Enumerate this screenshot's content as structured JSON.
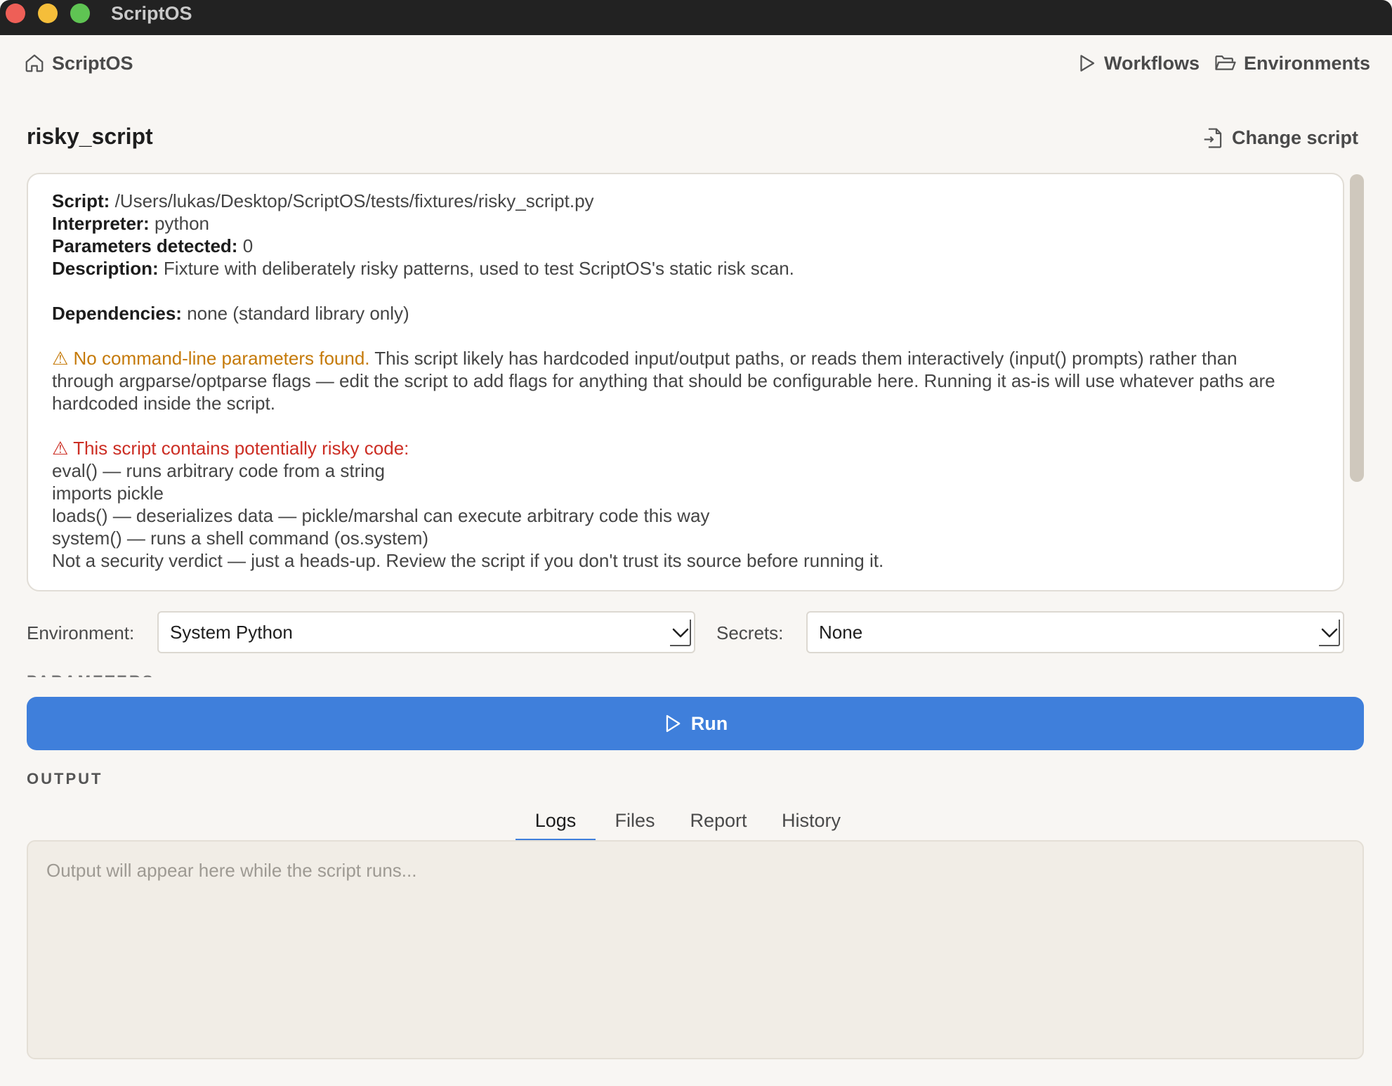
{
  "window": {
    "title": "ScriptOS"
  },
  "nav": {
    "home_label": "ScriptOS",
    "workflows_label": "Workflows",
    "environments_label": "Environments"
  },
  "script": {
    "name": "risky_script",
    "change_label": "Change script",
    "info": {
      "script_label": "Script:",
      "script_path": "/Users/lukas/Desktop/ScriptOS/tests/fixtures/risky_script.py",
      "interpreter_label": "Interpreter:",
      "interpreter": "python",
      "params_label": "Parameters detected:",
      "params_count": "0",
      "description_label": "Description:",
      "description": "Fixture with deliberately risky patterns, used to test ScriptOS's static risk scan.",
      "dependencies_label": "Dependencies:",
      "dependencies": "none (standard library only)",
      "no_params_warning_title": "⚠ No command-line parameters found.",
      "no_params_warning_line1": " This script likely has hardcoded input/output paths, or reads them interactively (input() prompts) rather than",
      "no_params_warning_line2": "through argparse/optparse flags — edit the script to add flags for anything that should be configurable here. Running it as-is will use whatever paths are",
      "no_params_warning_line3": "hardcoded inside the script.",
      "risk_title": "⚠ This script contains potentially risky code:",
      "risks": [
        "eval() — runs arbitrary code from a string",
        "imports pickle",
        "loads() — deserializes data — pickle/marshal can execute arbitrary code this way",
        "system() — runs a shell command (os.system)"
      ],
      "risk_footer": "Not a security verdict — just a heads-up. Review the script if you don't trust its source before running it."
    }
  },
  "controls": {
    "environment_label": "Environment:",
    "environment_value": "System Python",
    "secrets_label": "Secrets:",
    "secrets_value": "None",
    "parameters_label": "PARAMETERS",
    "run_label": "Run"
  },
  "output": {
    "section_label": "OUTPUT",
    "tabs": [
      "Logs",
      "Files",
      "Report",
      "History"
    ],
    "active_tab": "Logs",
    "placeholder": "Output will appear here while the script runs..."
  },
  "colors": {
    "accent": "#3f7fdb",
    "warning": "#c57a0a",
    "danger": "#cc2e24"
  }
}
